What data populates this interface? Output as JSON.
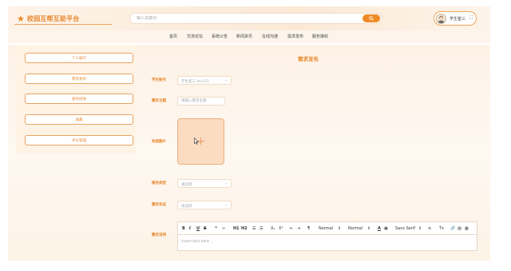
{
  "header": {
    "logo_text": "校园互帮互助平台",
    "search": {
      "placeholder": "输入关键词"
    },
    "user": {
      "name": "学生崔三"
    }
  },
  "nav": {
    "items": [
      "首页",
      "交流论坛",
      "系统公告",
      "新闻资讯",
      "在线沟通",
      "需求发布",
      "服务接收"
    ]
  },
  "sidebar": {
    "items": [
      "个人展示",
      "需求发布",
      "服务接收",
      "收藏",
      "评论管理"
    ]
  },
  "form": {
    "title": "需求发布",
    "student_account": {
      "label": "学生账号",
      "value": "学生崔三 stu121"
    },
    "demand_subject": {
      "label": "需求主题",
      "placeholder": "请输入需求主题"
    },
    "cover_image": {
      "label": "封面图片"
    },
    "service_type": {
      "label": "服务类型",
      "value": "请选择"
    },
    "demand_status": {
      "label": "需求状态",
      "value": "请选择"
    },
    "demand_description": {
      "label": "需求说明",
      "toolbar": {
        "bold": "B",
        "italic": "I",
        "underline": "U",
        "strike": "S",
        "quote": "❞",
        "code": "‹›",
        "h1": "H1",
        "h2": "H2",
        "ordered_list": "☰",
        "bullet_list": "☰",
        "subscript": "X₁",
        "superscript": "X¹",
        "outdent": "⇤",
        "indent": "⇥",
        "direction": "¶",
        "size": "Normal",
        "header": "Normal",
        "font": "Sans Serif",
        "color": "A",
        "background": "▣",
        "align": "≡",
        "clean": "Tx",
        "link": "🔗",
        "image": "▨",
        "video": "▦"
      },
      "placeholder": "insert text here ..."
    }
  },
  "colors": {
    "accent": "#f08a24",
    "label": "#e8872e",
    "background": "#fdf3e7"
  }
}
